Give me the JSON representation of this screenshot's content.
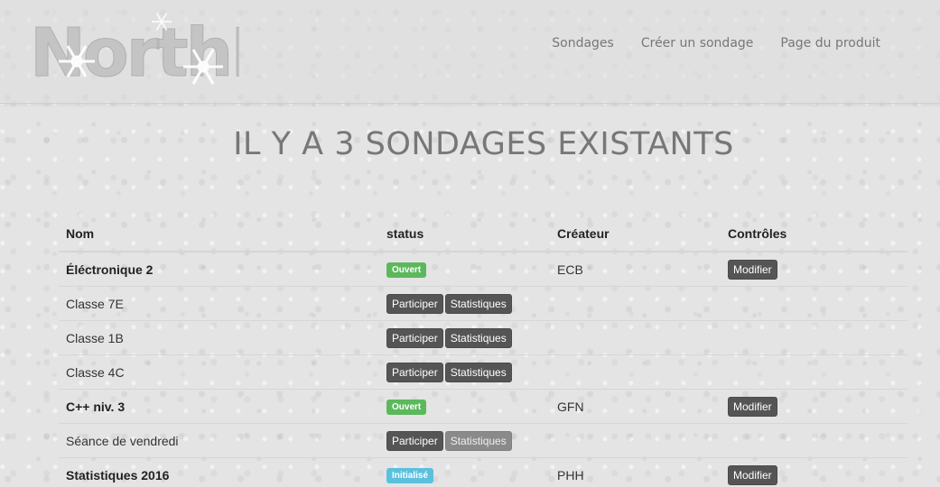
{
  "brand": {
    "logo_text": "NorthPoll"
  },
  "nav": {
    "items": [
      {
        "label": "Sondages"
      },
      {
        "label": "Créer un sondage"
      },
      {
        "label": "Page du produit"
      }
    ]
  },
  "main": {
    "title": "IL Y A 3 SONDAGES EXISTANTS",
    "table": {
      "headers": {
        "name": "Nom",
        "status": "status",
        "creator": "Créateur",
        "controls": "Contrôles"
      },
      "polls": [
        {
          "name": "Éléctronique 2",
          "status": "Ouvert",
          "status_color": "#5cb85c",
          "creator": "ECB",
          "control": "Modifier"
        },
        {
          "class": "Classe 7E",
          "participate": "Participer",
          "stats": "Statistiques"
        },
        {
          "class": "Classe 1B",
          "participate": "Participer",
          "stats": "Statistiques"
        },
        {
          "class": "Classe 4C",
          "participate": "Participer",
          "stats": "Statistiques"
        },
        {
          "name": "C++ niv. 3",
          "status": "Ouvert",
          "status_color": "#5cb85c",
          "creator": "GFN",
          "control": "Modifier"
        },
        {
          "class": "Séance de vendredi",
          "participate": "Participer",
          "stats": "Statistiques",
          "stats_disabled": true
        },
        {
          "name": "Statistiques 2016",
          "status": "Initialisé",
          "status_color": "#5bc0de",
          "creator": "PHH",
          "control": "Modifier"
        }
      ]
    }
  }
}
